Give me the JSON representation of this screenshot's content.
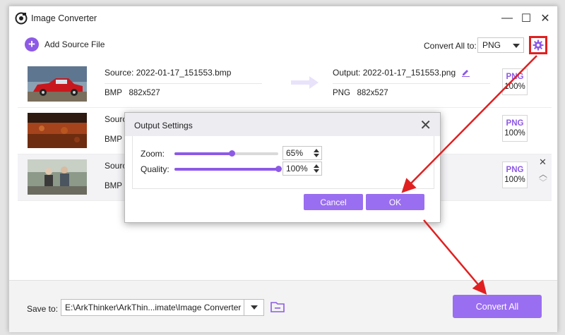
{
  "window": {
    "title": "Image Converter",
    "minimize": "—",
    "maximize": "☐",
    "close": "✕"
  },
  "toolbar": {
    "add_label": "Add Source File",
    "add_symbol": "+",
    "convert_all_to": "Convert All to:",
    "format": "PNG"
  },
  "files": [
    {
      "source": "Source: 2022-01-17_151553.bmp",
      "src_format": "BMP",
      "src_size": "882x527",
      "output": "Output: 2022-01-17_151553.png",
      "out_format": "PNG",
      "out_size": "882x527",
      "badge_format": "PNG",
      "badge_percent": "100%"
    },
    {
      "source": "Source",
      "src_format": "BMP",
      "badge_format": "PNG",
      "badge_percent": "100%"
    },
    {
      "source": "Source",
      "src_format": "BMP",
      "badge_format": "PNG",
      "badge_percent": "100%"
    }
  ],
  "row_controls": {
    "close": "✕",
    "up": "︿",
    "down": "﹀"
  },
  "dialog": {
    "title": "Output Settings",
    "close": "✕",
    "zoom_label": "Zoom:",
    "zoom_value": "65%",
    "zoom_level": 0.55,
    "quality_label": "Quality:",
    "quality_value": "100%",
    "quality_level": 1.0,
    "cancel": "Cancel",
    "ok": "OK"
  },
  "footer": {
    "save_label": "Save to:",
    "save_path": "E:\\ArkThinker\\ArkThin...imate\\Image Converter",
    "convert_all": "Convert All"
  },
  "colors": {
    "accent": "#8d5ae6",
    "button": "#9a6ef0",
    "annotation": "#e02020"
  }
}
